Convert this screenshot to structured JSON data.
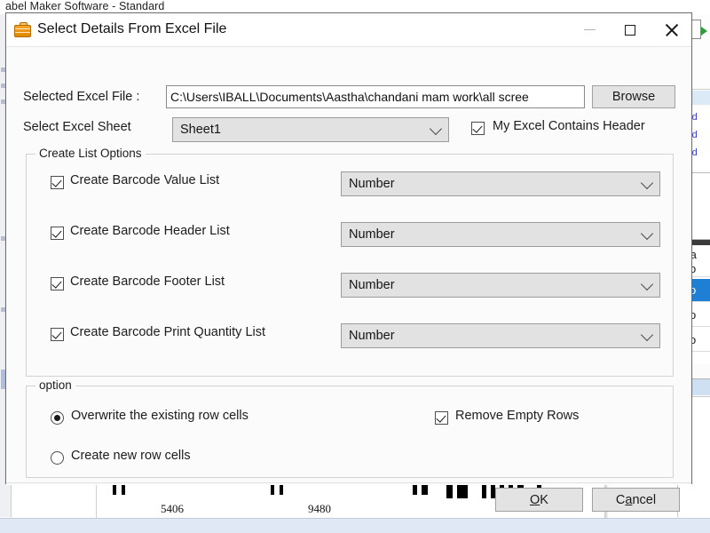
{
  "background": {
    "app_title": "abel Maker Software - Standard",
    "right_panel": {
      "links": [
        "cod",
        "cod",
        "cod"
      ],
      "list_items": [
        {
          "label": "Ba\nFo",
          "selected": false
        },
        {
          "label": "Fo",
          "selected": true
        },
        {
          "label": "Fo",
          "selected": false
        },
        {
          "label": "Fo",
          "selected": false
        }
      ]
    },
    "barcode_preview": {
      "labels": [
        "5406",
        "9480"
      ]
    }
  },
  "dialog": {
    "title": "Select Details From Excel File",
    "icon": "briefcase-icon",
    "window_controls": {
      "minimize": "minimize-icon",
      "maximize": "maximize-icon",
      "close": "close-icon"
    },
    "excel_file": {
      "label": "Selected Excel File :",
      "value": "C:\\Users\\IBALL\\Documents\\Aastha\\chandani mam work\\all scree",
      "placeholder": "",
      "browse_label": "Browse"
    },
    "excel_sheet": {
      "label": "Select Excel Sheet",
      "value": "Sheet1",
      "options": [
        "Sheet1"
      ]
    },
    "header_checkbox": {
      "label": "My Excel Contains Header",
      "checked": true
    },
    "create_list_options": {
      "title": "Create List Options",
      "rows": [
        {
          "label": "Create Barcode Value List",
          "checked": true,
          "dropdown": "Number"
        },
        {
          "label": "Create Barcode Header List",
          "checked": true,
          "dropdown": "Number"
        },
        {
          "label": "Create Barcode Footer List",
          "checked": true,
          "dropdown": "Number"
        },
        {
          "label": "Create Barcode Print Quantity List",
          "checked": true,
          "dropdown": "Number"
        }
      ],
      "dropdown_options": [
        "Number"
      ]
    },
    "option_group": {
      "title": "option",
      "radios": [
        {
          "label": "Overwrite the existing row cells",
          "checked": true
        },
        {
          "label": "Create new row cells",
          "checked": false
        }
      ],
      "remove_empty_rows": {
        "label": "Remove Empty Rows",
        "checked": true
      }
    },
    "footer": {
      "ok_mnemonic": "O",
      "ok_rest": "K",
      "cancel_first": "C",
      "cancel_mnemonic": "a",
      "cancel_rest": "ncel"
    }
  }
}
